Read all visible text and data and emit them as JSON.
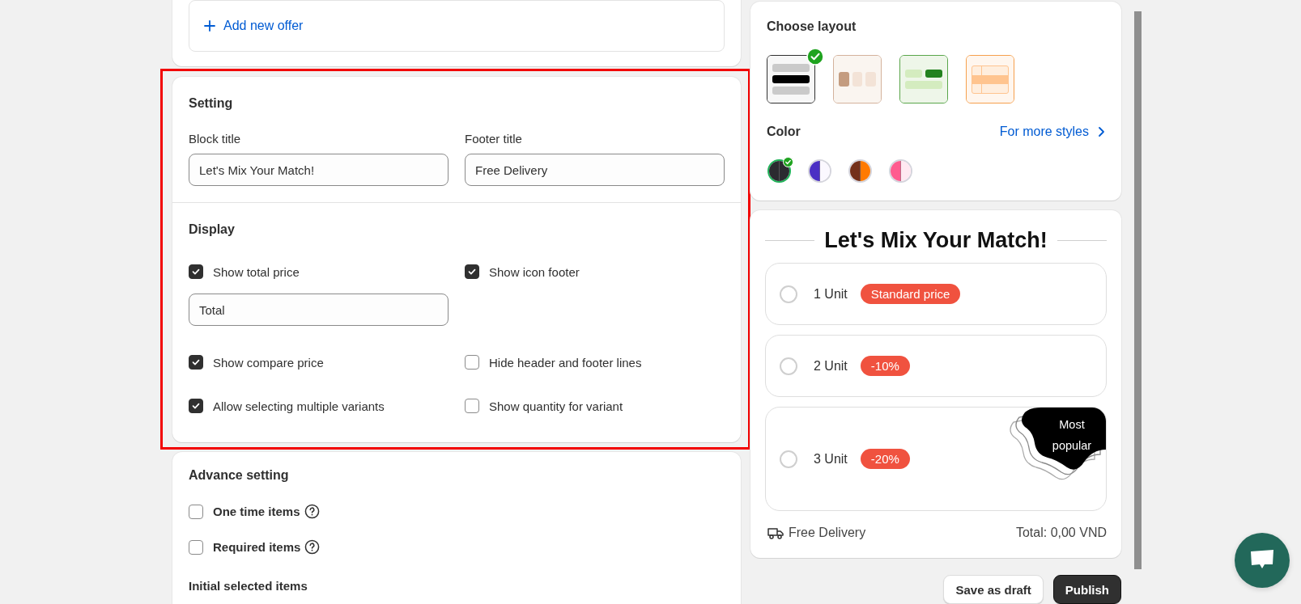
{
  "offer_card": {
    "add_link": "Add new offer"
  },
  "setting": {
    "title": "Setting",
    "highlighted": true,
    "fields": [
      {
        "label": "Block title",
        "value": "Let's Mix Your Match!"
      },
      {
        "label": "Footer title",
        "value": "Free Delivery"
      }
    ],
    "display_title": "Display",
    "options": [
      {
        "label": "Show total price",
        "checked": true,
        "value": "Total"
      },
      {
        "label": "Show icon footer",
        "checked": true
      },
      {
        "label": "Show compare price",
        "checked": true
      },
      {
        "label": "Hide header and footer lines",
        "checked": false
      },
      {
        "label": "Allow selecting multiple variants",
        "checked": true
      },
      {
        "label": "Show quantity for variant",
        "checked": false
      }
    ]
  },
  "advance": {
    "title": "Advance setting",
    "options": [
      {
        "label": "One time items",
        "checked": false
      },
      {
        "label": "Required items",
        "checked": false
      }
    ],
    "subheading": "Initial selected items"
  },
  "layout": {
    "title": "Choose layout",
    "layouts": [
      {
        "kind": "rows",
        "color": "#303030",
        "selected": true
      },
      {
        "kind": "columns",
        "color": "#d4b29c",
        "selected": false
      },
      {
        "kind": "grid",
        "color": "#5aa64a",
        "selected": false
      },
      {
        "kind": "table",
        "color": "#f6a04d",
        "selected": false
      }
    ],
    "color_title": "Color",
    "more_link": "For more styles",
    "swatches": [
      {
        "halves": [
          {
            "color": "#2b2b30"
          },
          {
            "color": "#2b2b30"
          }
        ],
        "selected": true
      },
      {
        "halves": [
          {
            "color": "#4a2fc4"
          },
          {
            "color": "#fbf8ff"
          }
        ],
        "selected": false
      },
      {
        "halves": [
          {
            "color": "#74301a"
          },
          {
            "color": "#ff7a00"
          }
        ],
        "selected": false
      },
      {
        "halves": [
          {
            "color": "#ff5b8f"
          },
          {
            "color": "#ffe9f1"
          }
        ],
        "selected": false
      }
    ]
  },
  "preview": {
    "title": "Let's Mix Your Match!",
    "offers": [
      {
        "label": "1 Unit",
        "badge": "Standard price",
        "selected": false
      },
      {
        "label": "2 Unit",
        "badge": "-10%",
        "selected": false
      },
      {
        "label": "3 Unit",
        "badge": "-20%",
        "selected": false,
        "ribbon": "Most popular"
      }
    ],
    "delivery": "Free Delivery",
    "total": "Total: 0,00 VND"
  },
  "buttons": [
    {
      "label": "Save as draft",
      "kind": "secondary"
    },
    {
      "label": "Publish",
      "kind": "primary"
    }
  ]
}
